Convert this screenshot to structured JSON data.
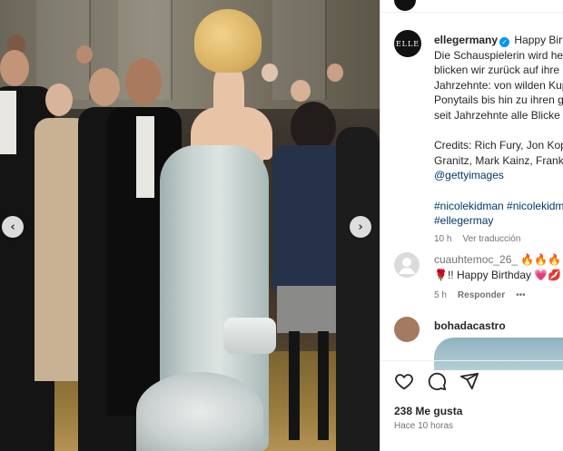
{
  "post": {
    "user": "ellegermany",
    "avatar_text": "ELLE",
    "caption_lines": [
      "Happy Birth",
      "Die Schauspielerin wird heu",
      "blicken wir zurück auf ihre",
      "Jahrzehnte: von wilden Kup",
      "Ponytails bis hin zu ihren g",
      "seit Jahrzehnte alle Blicke a"
    ],
    "credits_lines": [
      "Credits: Rich Fury, Jon Kopa",
      "Granitz, Mark Kainz, Frank T"
    ],
    "credits_link": "@gettyimages",
    "hashtags_line1": "#nicolekidman #nicolekidm",
    "hashtags_line2": "#ellegermay",
    "time": "10 h",
    "see_translation": "Ver traducción"
  },
  "comments": [
    {
      "user": "cuauhtemoc_26_",
      "text_suffix": "🔥🔥🔥",
      "line2": "🌹!! Happy Birthday 💗💋",
      "time": "5 h",
      "reply": "Responder",
      "more": "•••",
      "avatar_color": "#dbdbdb"
    },
    {
      "user": "bohadacastro",
      "avatar_color": "#a57a62"
    }
  ],
  "engagement": {
    "likes": "238 Me gusta",
    "posted": "Hace 10 horas"
  },
  "nav": {
    "prev": "‹",
    "next": "›"
  },
  "colors": {
    "accent": "#0095f6",
    "link": "#00376b",
    "muted": "#737373"
  },
  "icons": [
    "heart-icon",
    "comment-icon",
    "share-icon",
    "chevron-left-icon",
    "chevron-right-icon",
    "verified-icon"
  ]
}
